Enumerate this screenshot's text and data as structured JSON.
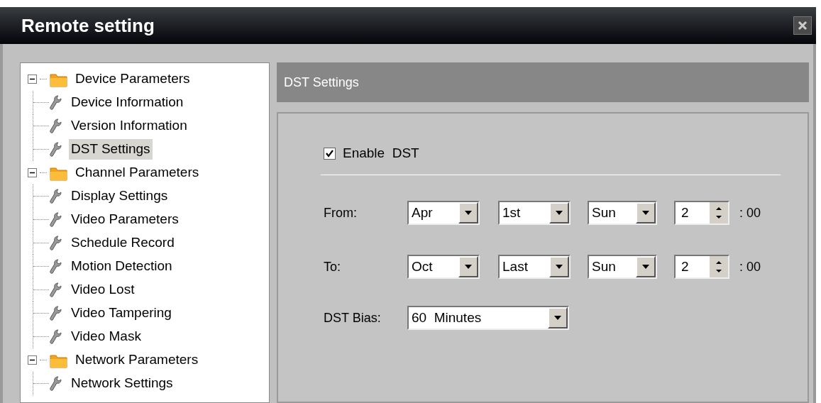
{
  "window": {
    "title": "Remote setting"
  },
  "tree": [
    {
      "label": "Device Parameters",
      "expanded": true,
      "children": [
        {
          "label": "Device Information",
          "selected": false
        },
        {
          "label": "Version Information",
          "selected": false
        },
        {
          "label": "DST Settings",
          "selected": true
        }
      ]
    },
    {
      "label": "Channel Parameters",
      "expanded": true,
      "children": [
        {
          "label": "Display Settings",
          "selected": false
        },
        {
          "label": "Video Parameters",
          "selected": false
        },
        {
          "label": "Schedule Record",
          "selected": false
        },
        {
          "label": "Motion Detection",
          "selected": false
        },
        {
          "label": "Video Lost",
          "selected": false
        },
        {
          "label": "Video Tampering",
          "selected": false
        },
        {
          "label": "Video Mask",
          "selected": false
        }
      ]
    },
    {
      "label": "Network Parameters",
      "expanded": true,
      "children": [
        {
          "label": "Network Settings",
          "selected": false
        }
      ]
    }
  ],
  "panel": {
    "title": "DST Settings",
    "enable": {
      "label": "Enable  DST",
      "checked": true
    },
    "rows": [
      {
        "label": "From:",
        "month": "Apr",
        "week": "1st",
        "day": "Sun",
        "hour": "2",
        "suffix": ": 00"
      },
      {
        "label": "To:",
        "month": "Oct",
        "week": "Last",
        "day": "Sun",
        "hour": "2",
        "suffix": ": 00"
      }
    ],
    "bias": {
      "label": "DST Bias:",
      "value": "60  Minutes"
    }
  }
}
